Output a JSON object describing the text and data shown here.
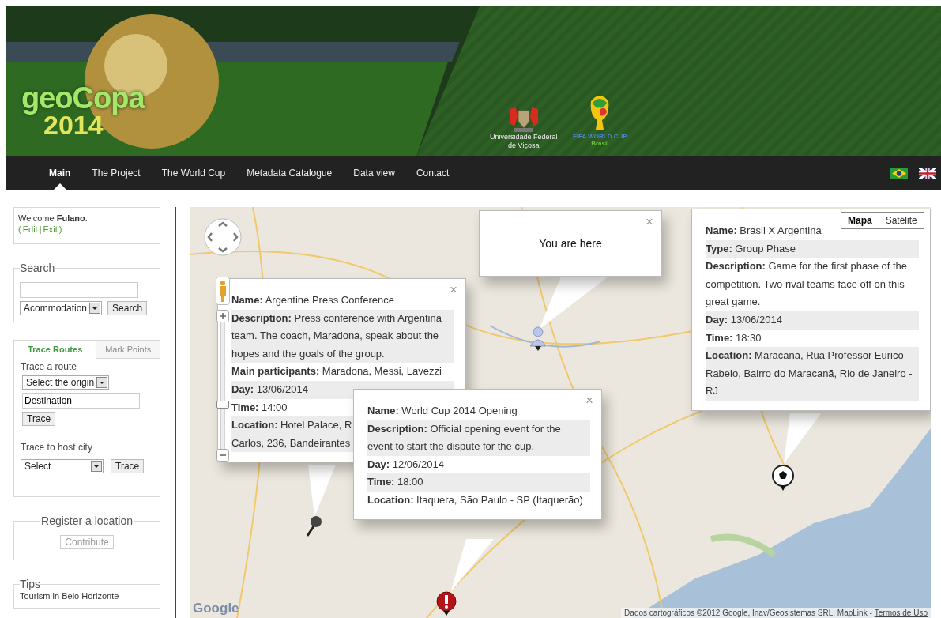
{
  "header": {
    "logo_word": "geoCopa",
    "logo_year": "2014",
    "university": [
      "Universidade Federal",
      "de Viçosa"
    ],
    "cup_title": "FIFA WORLD CUP",
    "cup_country": "Brasil"
  },
  "nav": {
    "items": [
      {
        "label": "Main",
        "selected": true
      },
      {
        "label": "The Project",
        "selected": false
      },
      {
        "label": "The World Cup",
        "selected": false
      },
      {
        "label": "Metadata Catalogue",
        "selected": false
      },
      {
        "label": "Data view",
        "selected": false
      },
      {
        "label": "Contact",
        "selected": false
      }
    ]
  },
  "sidebar": {
    "welcome": {
      "text": "Welcome **Fulano**.",
      "open": "(",
      "links": [
        "Edit",
        "Exit"
      ],
      "separator": "|",
      "close": ")"
    },
    "search": {
      "legend": "Search",
      "category": "Acommodation",
      "button": "Search"
    },
    "routes": {
      "tabs": [
        {
          "label": "Trace Routes",
          "selected": true
        },
        {
          "label": "Mark Points",
          "selected": false
        }
      ],
      "route_label": "Trace a route",
      "origin": "Select the origin",
      "destination": "Destination",
      "trace_button": "Trace",
      "host_label": "Trace to host city",
      "host_select": "Select",
      "host_button": "Trace"
    },
    "register": {
      "legend": "Register a location",
      "button": "Contribute",
      "disabled": true
    },
    "tips": {
      "legend": "Tips",
      "items": [
        "Tourism in Belo Horizonte"
      ]
    }
  },
  "map": {
    "map_types": [
      {
        "label": "Mapa",
        "selected": true
      },
      {
        "label": "Satélite",
        "selected": false
      }
    ],
    "zoom": {
      "level": 0.35
    },
    "markers": [
      {
        "kind": "person"
      },
      {
        "kind": "ball"
      },
      {
        "kind": "alert"
      },
      {
        "kind": "pin"
      }
    ],
    "popups": [
      {
        "kind": "info",
        "close": "×",
        "fields": [
          {
            "label": "Name:",
            "value": "Argentine Press Conference"
          },
          {
            "label": "Description:",
            "value": "Press conference with Argentina team. The coach, Maradona, speak about the hopes and the goals of the group."
          },
          {
            "label": "Main participants:",
            "value": "Maradona, Messi, Lavezzi"
          },
          {
            "label": "Day:",
            "value": "13/06/2014"
          },
          {
            "label": "Time:",
            "value": "14:00"
          },
          {
            "label": "Location:",
            "value": "Hotel Palace, R\nCarlos, 236, Bandeirantes"
          }
        ]
      },
      {
        "kind": "note",
        "close": "×",
        "text": "You are here"
      },
      {
        "kind": "info",
        "fields": [
          {
            "label": "Name:",
            "value": "Brasil X Argentina"
          },
          {
            "label": "Type:",
            "value": "Group Phase"
          },
          {
            "label": "Description:",
            "value": "Game for the first phase of the competition. Two rival teams face off on this great game."
          },
          {
            "label": "Day:",
            "value": "13/06/2014"
          },
          {
            "label": "Time:",
            "value": "18:30"
          },
          {
            "label": "Location:",
            "value": "Maracanã, Rua Professor Eurico Rabelo, Bairro do Maracanã, Rio de Janeiro - RJ"
          }
        ]
      },
      {
        "kind": "info",
        "close": "×",
        "fields": [
          {
            "label": "Name:",
            "value": "World Cup 2014 Opening"
          },
          {
            "label": "Description:",
            "value": "Official opening event for the event to start the dispute for the cup."
          },
          {
            "label": "Day:",
            "value": "12/06/2014"
          },
          {
            "label": "Time:",
            "value": "18:00"
          },
          {
            "label": "Location:",
            "value": "Itaquera, São Paulo - SP (Itaquerão)"
          }
        ]
      }
    ],
    "google_logo": "Google",
    "attribution": "Dados cartográficos ©2012 Google, Inav/Geosistemas SRL, MapLink -",
    "terms": "Termos de Uso"
  }
}
